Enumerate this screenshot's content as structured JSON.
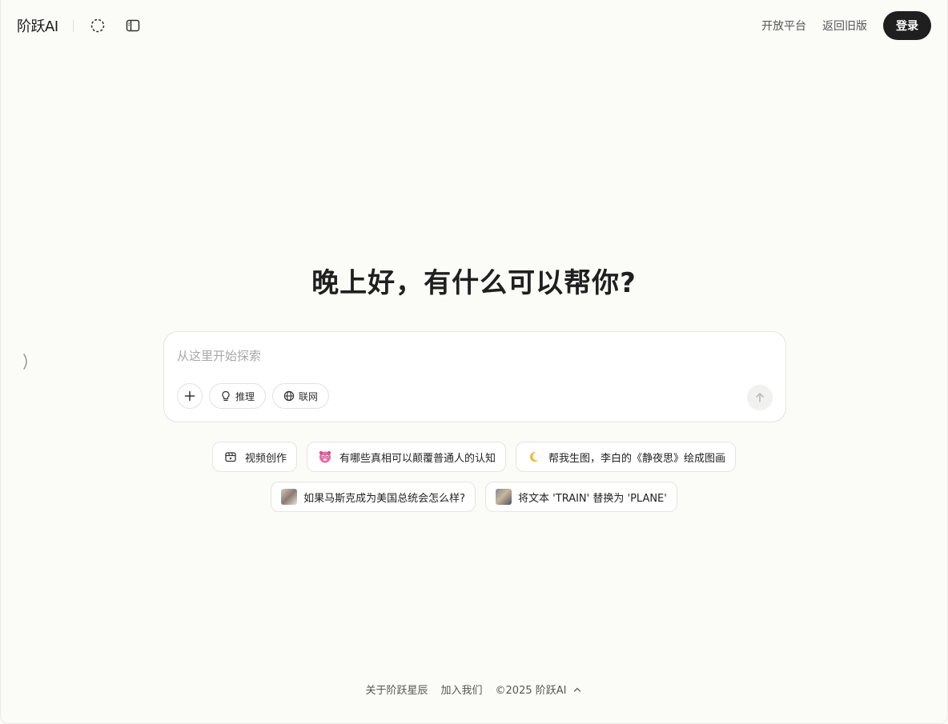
{
  "header": {
    "logo": "阶跃AI",
    "links": [
      "开放平台",
      "返回旧版"
    ],
    "login_label": "登录"
  },
  "main": {
    "greeting": "晚上好，有什么可以帮你?"
  },
  "composer": {
    "placeholder": "从这里开始探索",
    "tools": {
      "reason_label": "推理",
      "web_label": "联网"
    }
  },
  "suggestions": {
    "row1": [
      {
        "label": "视频创作",
        "icon": "video-calendar-icon"
      },
      {
        "label": "有哪些真相可以颠覆普通人的认知",
        "icon": "pink-face-emoji"
      },
      {
        "label": "帮我生图，李白的《静夜思》绘成图画",
        "icon": "crescent-moon-emoji"
      }
    ],
    "row2": [
      {
        "label": "如果马斯克成为美国总统会怎么样?",
        "icon": "photo-thumbnail"
      },
      {
        "label": "将文本 'TRAIN' 替换为 'PLANE'",
        "icon": "photo-thumbnail"
      }
    ]
  },
  "footer": {
    "about": "关于阶跃星辰",
    "join": "加入我们",
    "copyright": "©2025 阶跃AI"
  },
  "colors": {
    "background": "#fbfbf8",
    "primary_button": "#1f1f1f",
    "border": "#e6e4df"
  }
}
